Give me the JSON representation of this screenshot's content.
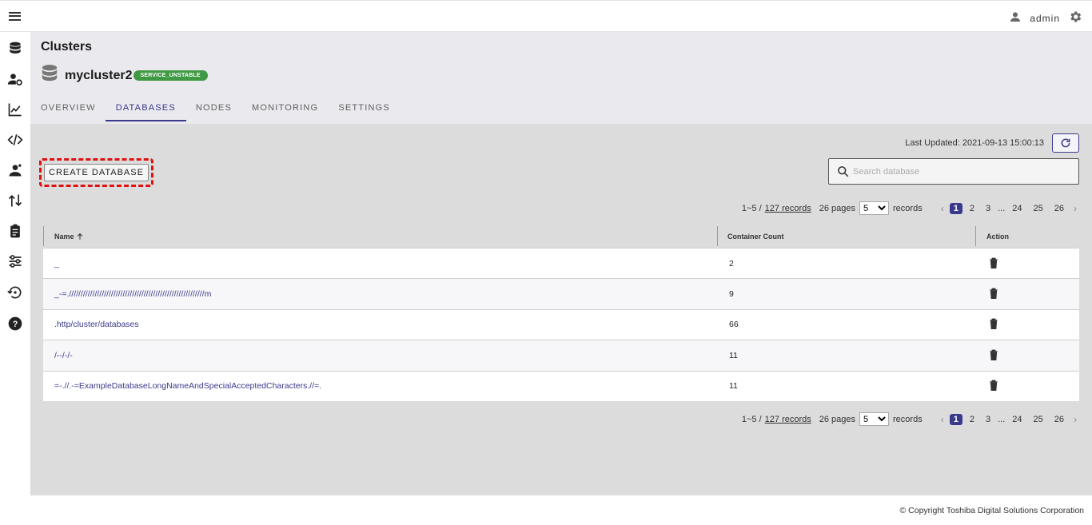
{
  "topbar": {
    "username": "admin"
  },
  "header": {
    "title": "Clusters",
    "cluster_name": "mycluster2",
    "status": "SERVICE_UNSTABLE",
    "tabs": [
      {
        "label": "OVERVIEW"
      },
      {
        "label": "DATABASES"
      },
      {
        "label": "NODES"
      },
      {
        "label": "MONITORING"
      },
      {
        "label": "SETTINGS"
      }
    ],
    "active_tab": "DATABASES"
  },
  "toolbar": {
    "last_updated": "Last Updated: 2021-09-13 15:00:13",
    "create_label": "CREATE DATABASE",
    "search_placeholder": "Search database"
  },
  "pagination": {
    "range": "1~5 /",
    "records_link": "127 records",
    "pages_label": "26 pages",
    "page_size": "5",
    "records_word": "records",
    "pages": [
      "1",
      "2",
      "3",
      "24",
      "25",
      "26"
    ],
    "ellipsis": "...",
    "current": "1"
  },
  "table": {
    "columns": [
      "Name",
      "Container Count",
      "Action"
    ],
    "rows": [
      {
        "name": "_",
        "count": "2"
      },
      {
        "name": "_-=.//////////////////////////////////////////////////////////m",
        "count": "9"
      },
      {
        "name": ".http/cluster/databases",
        "count": "66"
      },
      {
        "name": "/--/-/-",
        "count": "11"
      },
      {
        "name": "=-.//.-=ExampleDatabaseLongNameAndSpecialAcceptedCharacters.//=.",
        "count": "11"
      }
    ]
  },
  "footer": {
    "copyright": "© Copyright Toshiba Digital Solutions Corporation"
  },
  "colors": {
    "accent": "#3a3a8c",
    "status_green": "#3f9a43",
    "highlight_red": "#e01010"
  }
}
